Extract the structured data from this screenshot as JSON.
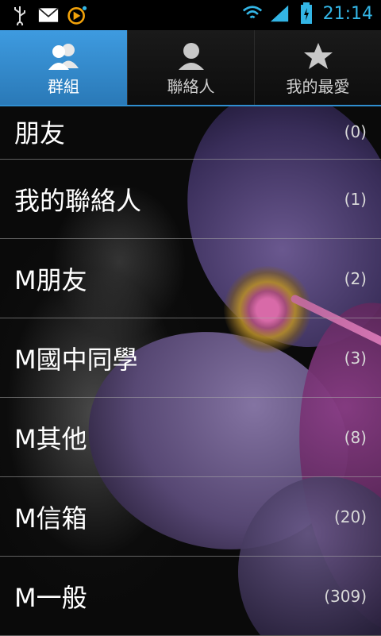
{
  "status_bar": {
    "time": "21:14",
    "icons": [
      "usb-icon",
      "gmail-icon",
      "navigation-icon",
      "wifi-icon",
      "signal-icon",
      "battery-charging-icon"
    ]
  },
  "tabs": [
    {
      "label": "群組",
      "icon": "groups-icon",
      "active": true
    },
    {
      "label": "聯絡人",
      "icon": "contact-icon",
      "active": false
    },
    {
      "label": "我的最愛",
      "icon": "star-icon",
      "active": false
    }
  ],
  "groups": [
    {
      "name": "朋友",
      "count": "(0)"
    },
    {
      "name": "我的聯絡人",
      "count": "(1)"
    },
    {
      "name": "M朋友",
      "count": "(2)"
    },
    {
      "name": "M國中同學",
      "count": "(3)"
    },
    {
      "name": "M其他",
      "count": "(8)"
    },
    {
      "name": "M信箱",
      "count": "(20)"
    },
    {
      "name": "M一般",
      "count": "(309)"
    }
  ],
  "colors": {
    "accent": "#33b5e5",
    "active_tab": "#3e9be0"
  }
}
